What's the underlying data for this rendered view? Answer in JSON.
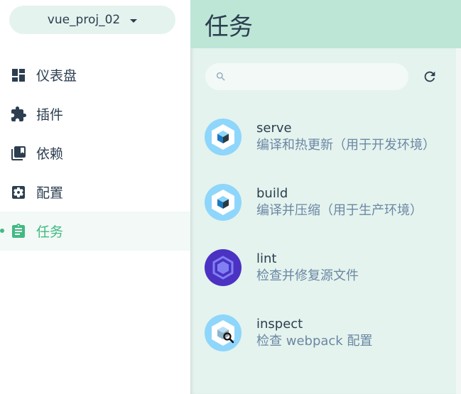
{
  "project": {
    "name": "vue_proj_02"
  },
  "nav": {
    "items": [
      {
        "label": "仪表盘",
        "icon": "dashboard-icon"
      },
      {
        "label": "插件",
        "icon": "puzzle-icon"
      },
      {
        "label": "依赖",
        "icon": "library-icon"
      },
      {
        "label": "配置",
        "icon": "settings-icon"
      },
      {
        "label": "任务",
        "icon": "clipboard-icon",
        "active": true
      }
    ]
  },
  "header": {
    "title": "任务"
  },
  "search": {
    "placeholder": "",
    "value": ""
  },
  "tasks": [
    {
      "name": "serve",
      "description": "编译和热更新（用于开发环境）",
      "icon": "webpack-icon"
    },
    {
      "name": "build",
      "description": "编译并压缩（用于生产环境）",
      "icon": "webpack-icon"
    },
    {
      "name": "lint",
      "description": "检查并修复源文件",
      "icon": "eslint-icon"
    },
    {
      "name": "inspect",
      "description": "检查 webpack 配置",
      "icon": "webpack-inspect-icon"
    }
  ],
  "colors": {
    "accent": "#42b983",
    "header_bg": "#bde6d7",
    "main_bg": "#e4f3ed",
    "text": "#2c3e50",
    "subtext": "#6b87a5"
  }
}
